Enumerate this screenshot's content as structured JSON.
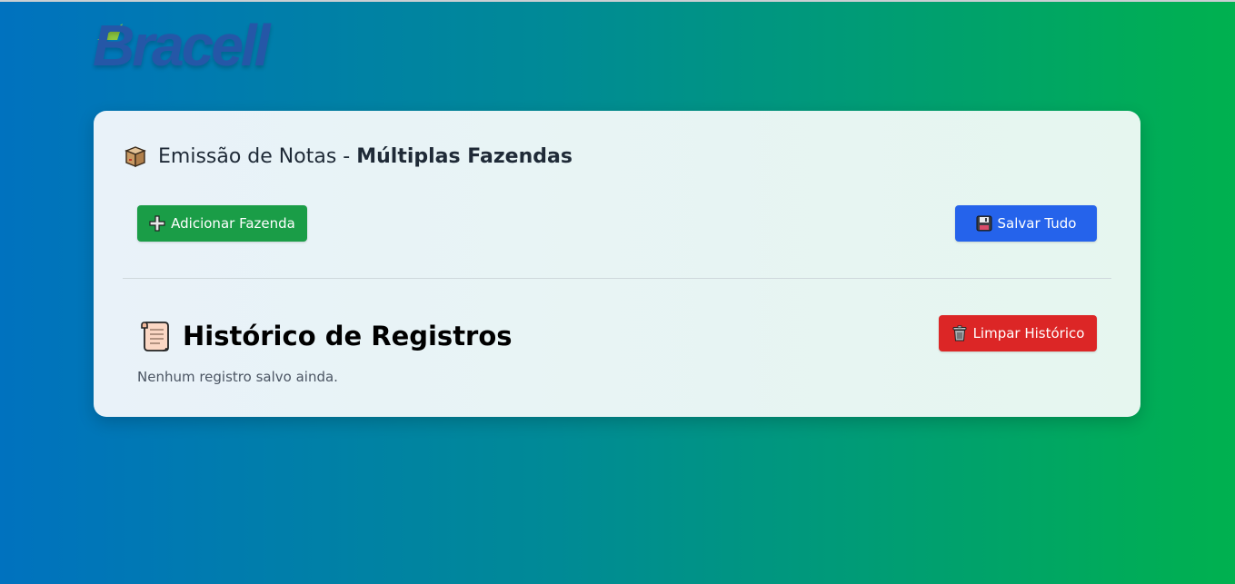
{
  "brand": {
    "logo_text": "Bracell",
    "logo_icon": "leaf-icon"
  },
  "emission": {
    "title_prefix": "Emissão de Notas - ",
    "title_strong": "Múltiplas Fazendas",
    "title_icon": "package-icon"
  },
  "actions": {
    "add_farm_label": "Adicionar Fazenda",
    "add_farm_icon": "plus-icon",
    "save_all_label": "Salvar Tudo",
    "save_all_icon": "floppy-disk-icon"
  },
  "history": {
    "title": "Histórico de Registros",
    "title_icon": "scroll-icon",
    "clear_label": "Limpar Histórico",
    "clear_icon": "trash-icon",
    "empty_message": "Nenhum registro salvo ainda."
  },
  "colors": {
    "add_button": "#1a9d47",
    "save_button": "#2563eb",
    "clear_button": "#dc2626",
    "logo": "#2557a7"
  }
}
